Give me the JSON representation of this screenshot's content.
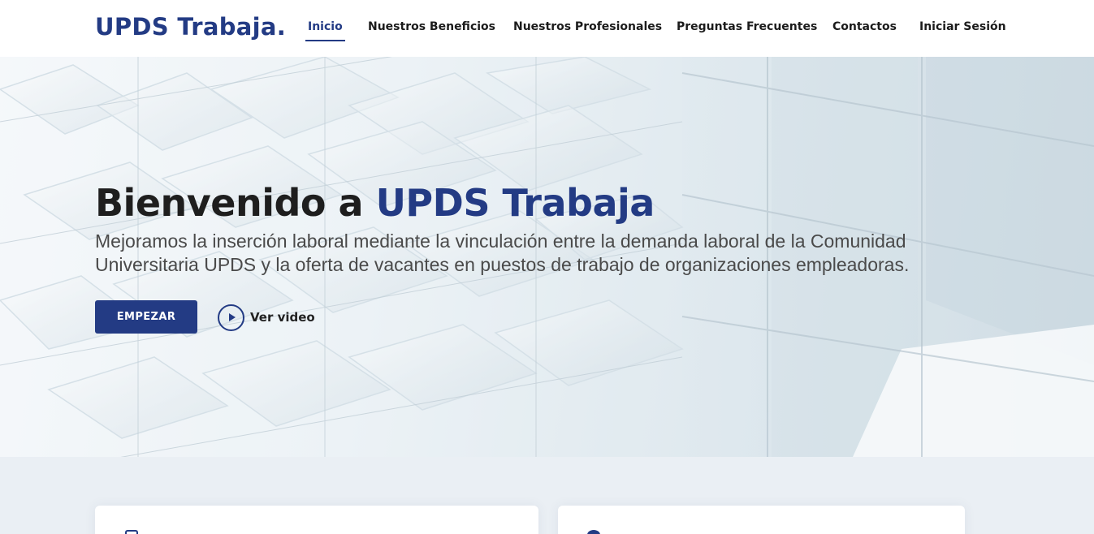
{
  "header": {
    "logo": "UPDS Trabaja.",
    "nav": [
      {
        "label": "Inicio",
        "active": true
      },
      {
        "label": "Nuestros Beneficios",
        "active": false
      },
      {
        "label": "Nuestros Profesionales",
        "active": false
      },
      {
        "label": "Preguntas Frecuentes",
        "active": false
      },
      {
        "label": "Contactos",
        "active": false
      },
      {
        "label": "Iniciar Sesión",
        "active": false
      }
    ]
  },
  "hero": {
    "title_prefix": "Bienvenido a ",
    "title_brand": "UPDS Trabaja",
    "subtitle": "Mejoramos la inserción laboral mediante la vinculación entre la demanda laboral de la Comunidad Universitaria UPDS y la oferta de vacantes en puestos de trabajo de organizaciones empleadoras.",
    "start_button": "EMPEZAR",
    "video_label": "Ver video"
  },
  "colors": {
    "brand": "#233b84",
    "text_dark": "#1e1e1e",
    "section_bg": "#eaeff4"
  },
  "icons": {
    "play": "play-icon",
    "card_1": "briefcase-icon",
    "card_2": "user-icon"
  }
}
